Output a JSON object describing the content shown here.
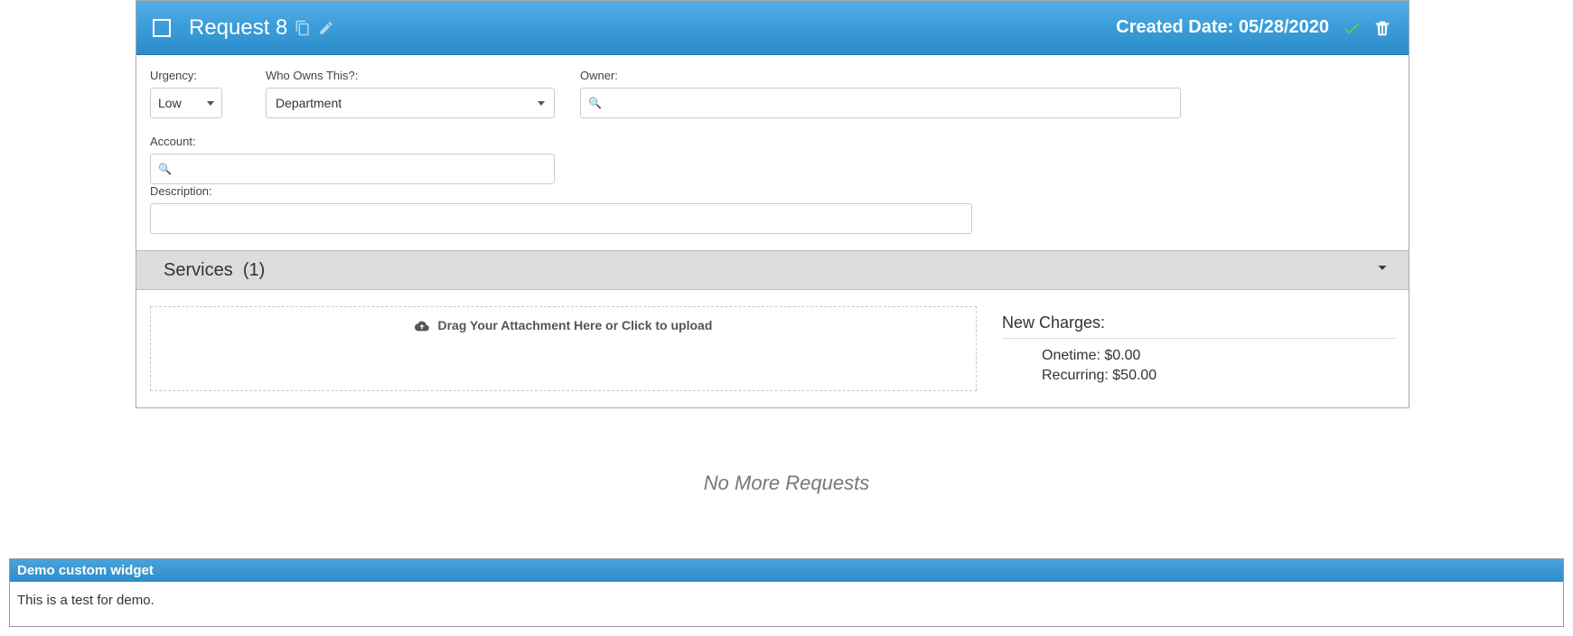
{
  "header": {
    "title": "Request 8",
    "created_label": "Created Date:",
    "created_date": "05/28/2020"
  },
  "form": {
    "urgency": {
      "label": "Urgency:",
      "value": "Low"
    },
    "who_owns": {
      "label": "Who Owns This?:",
      "value": "Department"
    },
    "owner": {
      "label": "Owner:",
      "value": ""
    },
    "account": {
      "label": "Account:",
      "value": ""
    },
    "description": {
      "label": "Description:",
      "value": ""
    }
  },
  "services": {
    "label": "Services",
    "count": "(1)"
  },
  "dropzone": {
    "text": "Drag Your Attachment Here or Click to upload"
  },
  "charges": {
    "title": "New Charges:",
    "onetime_label": "Onetime:",
    "onetime_value": "$0.00",
    "recurring_label": "Recurring:",
    "recurring_value": "$50.00"
  },
  "no_more": "No More Requests",
  "widget": {
    "title": "Demo custom widget",
    "body": "This is a test for demo."
  }
}
